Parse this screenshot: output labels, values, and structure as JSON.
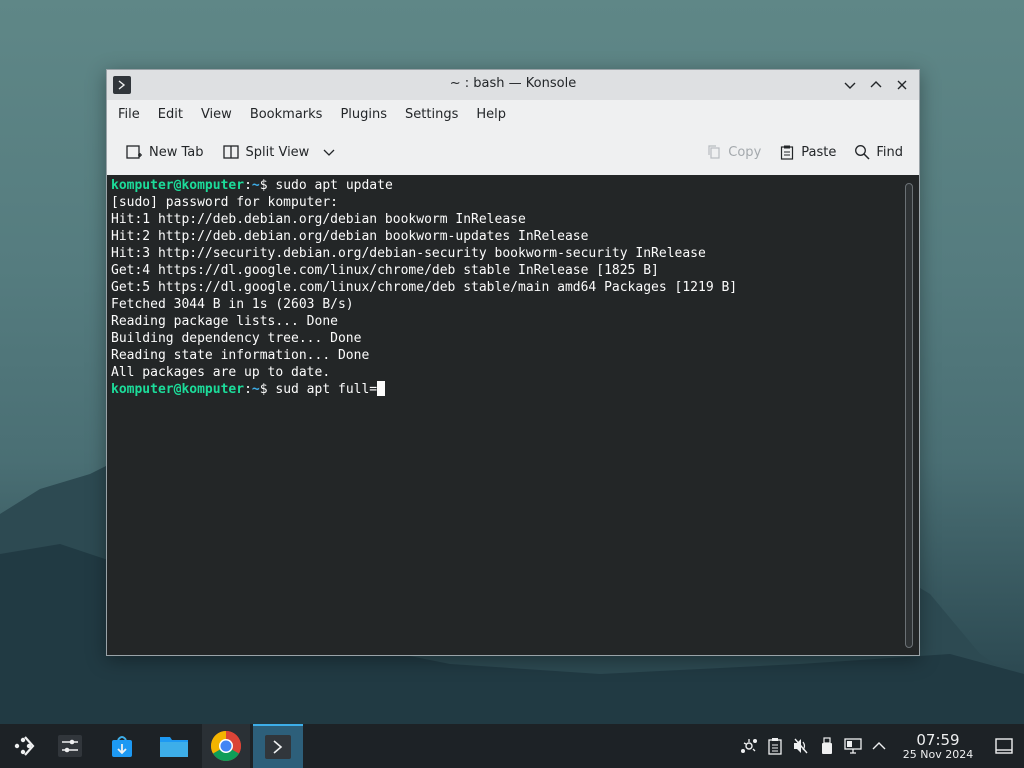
{
  "window": {
    "title": "~ : bash — Konsole",
    "menu": [
      "File",
      "Edit",
      "View",
      "Bookmarks",
      "Plugins",
      "Settings",
      "Help"
    ],
    "toolbar": {
      "new_tab": "New Tab",
      "split_view": "Split View",
      "copy": "Copy",
      "paste": "Paste",
      "find": "Find"
    }
  },
  "terminal": {
    "prompt_user": "komputer@komputer",
    "prompt_sep": ":",
    "prompt_path": "~",
    "prompt_sym": "$ ",
    "command1": "sudo apt update",
    "output": [
      "[sudo] password for komputer:",
      "Hit:1 http://deb.debian.org/debian bookworm InRelease",
      "Hit:2 http://deb.debian.org/debian bookworm-updates InRelease",
      "Hit:3 http://security.debian.org/debian-security bookworm-security InRelease",
      "Get:4 https://dl.google.com/linux/chrome/deb stable InRelease [1825 B]",
      "Get:5 https://dl.google.com/linux/chrome/deb stable/main amd64 Packages [1219 B]",
      "Fetched 3044 B in 1s (2603 B/s)",
      "Reading package lists... Done",
      "Building dependency tree... Done",
      "Reading state information... Done",
      "All packages are up to date."
    ],
    "command2": "sud apt full="
  },
  "taskbar": {
    "apps": [
      "application-launcher-icon",
      "system-settings-icon",
      "discover-store-icon",
      "file-manager-icon",
      "chrome-icon",
      "konsole-icon"
    ],
    "tray_icons": [
      "network-icon",
      "clipboard-icon",
      "volume-muted-icon",
      "usb-device-icon",
      "display-icon",
      "chevron-up-icon"
    ],
    "clock": {
      "time": "07:59",
      "date": "25 Nov 2024"
    }
  }
}
